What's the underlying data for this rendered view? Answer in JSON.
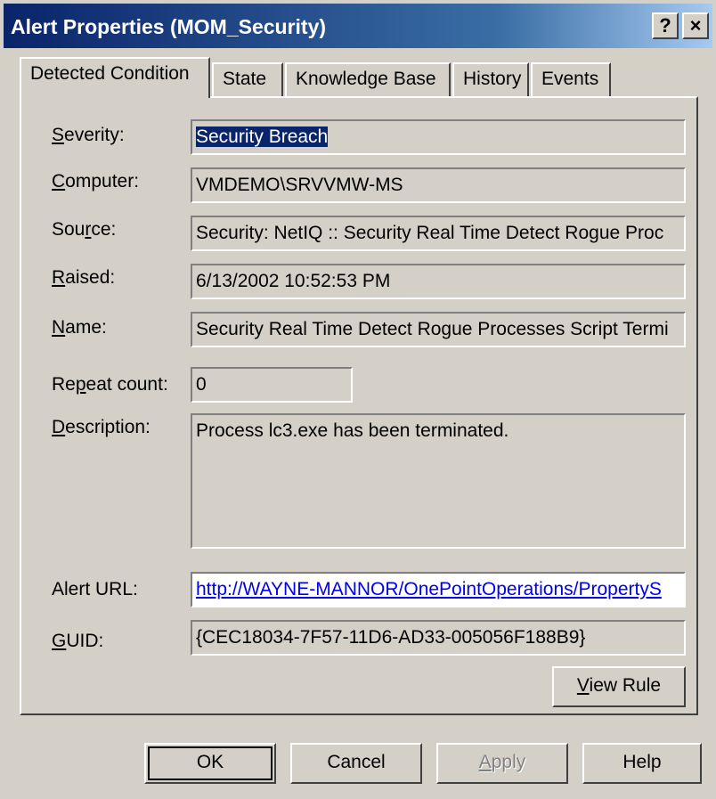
{
  "window": {
    "title": "Alert Properties (MOM_Security)",
    "help_label": "?",
    "close_label": "×"
  },
  "tabs": [
    {
      "label": "Detected Condition"
    },
    {
      "label": "State"
    },
    {
      "label": "Knowledge Base"
    },
    {
      "label": "History"
    },
    {
      "label": "Events"
    }
  ],
  "fields": {
    "severity": {
      "label_u": "S",
      "label_rest": "everity:",
      "value": "Security Breach"
    },
    "computer": {
      "label_u": "C",
      "label_rest": "omputer:",
      "value": "VMDEMO\\SRVVMW-MS"
    },
    "source": {
      "label_pre": "Sou",
      "label_u": "r",
      "label_rest": "ce:",
      "value": "Security: NetIQ :: Security Real Time Detect Rogue Proc"
    },
    "raised": {
      "label_u": "R",
      "label_rest": "aised:",
      "value": "6/13/2002 10:52:53 PM"
    },
    "name": {
      "label_u": "N",
      "label_rest": "ame:",
      "value": "Security Real Time Detect Rogue Processes Script Termi"
    },
    "repeat": {
      "label_pre": "Re",
      "label_u": "p",
      "label_rest": "eat count:",
      "value": "0"
    },
    "description": {
      "label_u": "D",
      "label_rest": "escription:",
      "value": "Process lc3.exe has been terminated."
    },
    "alert_url": {
      "label": "Alert URL:",
      "value": "http://WAYNE-MANNOR/OnePointOperations/PropertyS"
    },
    "guid": {
      "label_u": "G",
      "label_rest": "UID:",
      "value": "{CEC18034-7F57-11D6-AD33-005056F188B9}"
    }
  },
  "buttons": {
    "view_rule_u": "V",
    "view_rule_rest": "iew Rule",
    "ok": "OK",
    "cancel": "Cancel",
    "apply_u": "A",
    "apply_rest": "pply",
    "help": "Help"
  },
  "colors": {
    "selection": "#0a246a",
    "link": "#0000ee",
    "face": "#d4d0c8"
  }
}
